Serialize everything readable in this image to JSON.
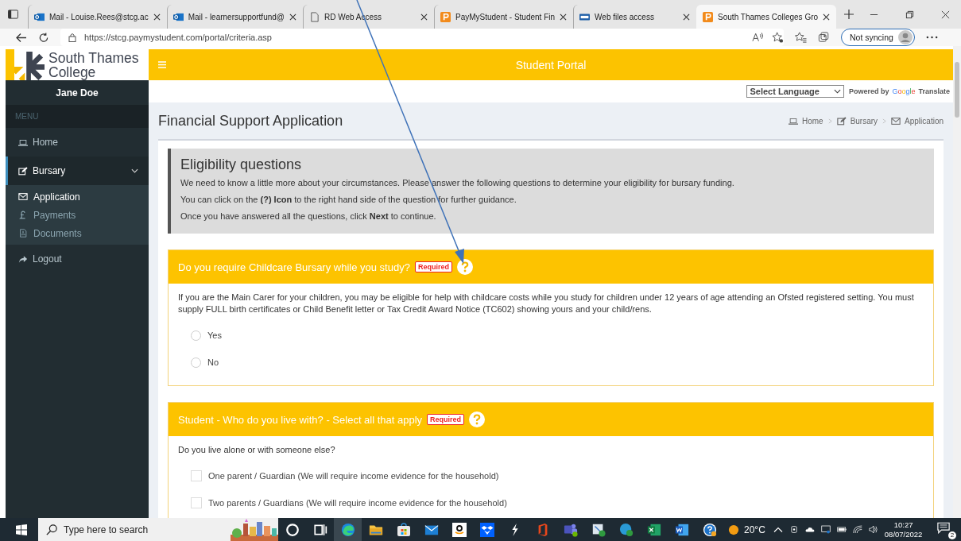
{
  "browser": {
    "tabs": [
      {
        "title": "Mail - Louise.Rees@stcg.ac",
        "selected": false
      },
      {
        "title": "Mail - learnersupportfund@",
        "selected": false
      },
      {
        "title": "RD Web Access",
        "selected": false
      },
      {
        "title": "PayMyStudent - Student Fin",
        "selected": false
      },
      {
        "title": "Web files access",
        "selected": false
      },
      {
        "title": "South Thames Colleges Gro",
        "selected": true
      }
    ],
    "url": "https://stcg.paymystudent.com/portal/criteria.asp",
    "sync": "Not syncing"
  },
  "header": {
    "logo_lines": [
      "South Thames",
      "College"
    ],
    "title": "Student Portal"
  },
  "translate": {
    "select": "Select Language",
    "powered_by": "Powered by",
    "google": "Google",
    "translate": "Translate"
  },
  "sidebar": {
    "user": "Jane Doe",
    "menu_label": "MENU",
    "items": [
      {
        "label": "Home",
        "selected": false
      },
      {
        "label": "Bursary",
        "selected": true,
        "expanded": true,
        "children": [
          {
            "label": "Application",
            "selected": true
          },
          {
            "label": "Payments",
            "selected": false
          },
          {
            "label": "Documents",
            "selected": false
          }
        ]
      },
      {
        "label": "Logout",
        "selected": false
      }
    ]
  },
  "page_title": "Financial Support Application",
  "breadcrumb": [
    "Home",
    "Bursary",
    "Application"
  ],
  "intro": {
    "title": "Eligibility questions",
    "lines": [
      "We need to know a little more about your circumstances. Please answer the following questions to determine your eligibility for bursary funding.",
      "You can click on the **(?) Icon** to the right hand side of the question for further guidance.",
      "Once you have answered all the questions, click **Next** to continue."
    ]
  },
  "questions": [
    {
      "title": "Do you require Childcare Bursary while you study?",
      "badge": "Required",
      "description": "If you are the Main Carer for your children, you may be eligible for help with childcare costs while you study for children under 12 years of age attending an Ofsted registered setting. You must supply FULL birth certificates or Child Benefit letter or Tax Credit Award Notice (TC602) showing yours and your child/rens.",
      "options": [
        {
          "label": "Yes",
          "kind": "radio",
          "selected": false
        },
        {
          "label": "No",
          "kind": "radio",
          "selected": false
        }
      ]
    },
    {
      "title": "Student - Who do you live with? - Select all that apply",
      "badge": "Required",
      "description": "Do you live alone or with someone else?",
      "options": [
        {
          "label": "One parent / Guardian (We will require income evidence for the household)",
          "kind": "checkbox",
          "checked": false
        },
        {
          "label": "Two parents / Guardians (We will require income evidence for the household)",
          "kind": "checkbox",
          "checked": false
        }
      ]
    }
  ],
  "taskbar": {
    "search_placeholder": "Type here to search",
    "apps": [
      {
        "selected": false
      },
      {
        "selected": false
      },
      {
        "selected": true
      },
      {
        "selected": false
      },
      {
        "selected": false
      },
      {
        "selected": false
      },
      {
        "selected": false
      },
      {
        "selected": false
      },
      {
        "selected": false
      },
      {
        "selected": false
      },
      {
        "selected": false
      },
      {
        "selected": false
      },
      {
        "selected": false
      },
      {
        "selected": false
      },
      {
        "selected": false
      },
      {
        "selected": false
      }
    ],
    "temperature": "20°C",
    "time": "10:27",
    "date": "08/07/2022",
    "notifications": "2"
  }
}
